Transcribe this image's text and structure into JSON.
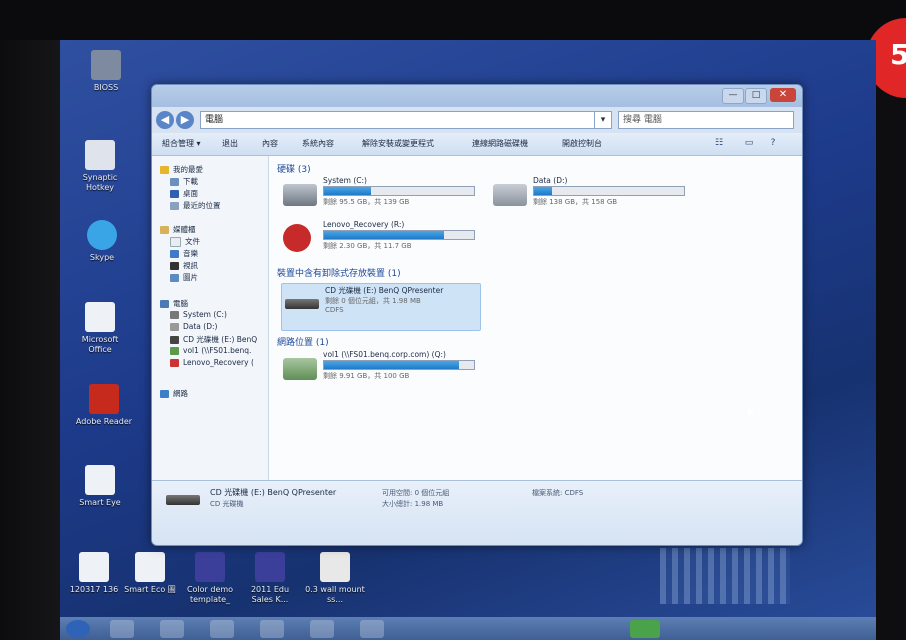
{
  "colors": {
    "desktop": "#1d3a8a",
    "window_frame": "#c8d8ec",
    "drive_bar": "#1f7ac9",
    "close": "#c9453a",
    "badge": "#e02626"
  },
  "badge": {
    "text": "5"
  },
  "desktop_icons": [
    {
      "label": "BIOSS",
      "icon": "app-icon"
    },
    {
      "label": "Synaptic Hotkey",
      "icon": "app-icon"
    },
    {
      "label": "Skype",
      "icon": "skype-icon"
    },
    {
      "label": "Microsoft Office",
      "icon": "document-icon"
    },
    {
      "label": "Adobe Reader",
      "icon": "pdf-icon"
    },
    {
      "label": "Smart Eye",
      "icon": "document-icon"
    },
    {
      "label": "120317 136",
      "icon": "document-icon"
    },
    {
      "label": "Smart Eco 圖",
      "icon": "document-icon"
    },
    {
      "label": "Color demo template_",
      "icon": "image-icon"
    },
    {
      "label": "2011 Edu Sales K...",
      "icon": "image-icon"
    },
    {
      "label": "0.3 wall mount ss...",
      "icon": "document-icon"
    }
  ],
  "window": {
    "title_buttons": {
      "minimize": "—",
      "maximize": "□",
      "close": "✕"
    },
    "address": {
      "path": "電腦",
      "search_placeholder": "搜尋 電腦"
    },
    "toolbar": {
      "items": [
        "組合管理 ▾",
        "退出",
        "內容",
        "系統內容",
        "解除安裝或變更程式",
        "連線網路磁碟機",
        "開啟控制台"
      ]
    },
    "sidebar": {
      "groups": [
        {
          "label": "我的最愛",
          "items": [
            "下載",
            "桌面",
            "最近的位置"
          ]
        },
        {
          "label": "媒體櫃",
          "items": [
            "文件",
            "音樂",
            "視訊",
            "圖片"
          ]
        },
        {
          "label": "電腦",
          "items": [
            "System (C:)",
            "Data (D:)",
            "CD 光碟機 (E:) BenQ",
            "vol1 (\\\\FS01.benq.",
            "Lenovo_Recovery ("
          ]
        },
        {
          "label": "網路",
          "items": []
        }
      ]
    },
    "sections": [
      {
        "label": "硬碟 (3)"
      },
      {
        "label": "裝置中含有卸除式存放裝置 (1)"
      },
      {
        "label": "網路位置 (1)"
      }
    ],
    "drives": [
      {
        "name": "System (C:)",
        "free": "剩餘 95.5 GB，共 139 GB",
        "fs": "",
        "used": 0.31,
        "icon": "hard-drive-icon"
      },
      {
        "name": "Data (D:)",
        "free": "剩餘 138 GB，共 158 GB",
        "fs": "",
        "used": 0.12,
        "icon": "hard-drive-icon"
      },
      {
        "name": "Lenovo_Recovery (R:)",
        "free": "剩餘 2.30 GB，共 11.7 GB",
        "fs": "",
        "used": 0.8,
        "icon": "recovery-drive-icon"
      },
      {
        "name": "CD 光碟機 (E:) BenQ QPresenter",
        "free": "剩餘 0 個位元組，共 1.98 MB",
        "fs": "CDFS",
        "used": 1.0,
        "icon": "cd-drive-icon"
      },
      {
        "name": "vol1 (\\\\FS01.benq.corp.com) (Q:)",
        "free": "剩餘 9.91 GB，共 100 GB",
        "fs": "",
        "used": 0.9,
        "icon": "network-drive-icon"
      }
    ],
    "details": {
      "name": "CD 光碟機 (E:) BenQ QPresenter",
      "type": "CD 光碟機",
      "space_free": "可用空間: 0 個位元組",
      "total_size": "大小總計: 1.98 MB",
      "filesystem": "檔案系統: CDFS"
    }
  }
}
